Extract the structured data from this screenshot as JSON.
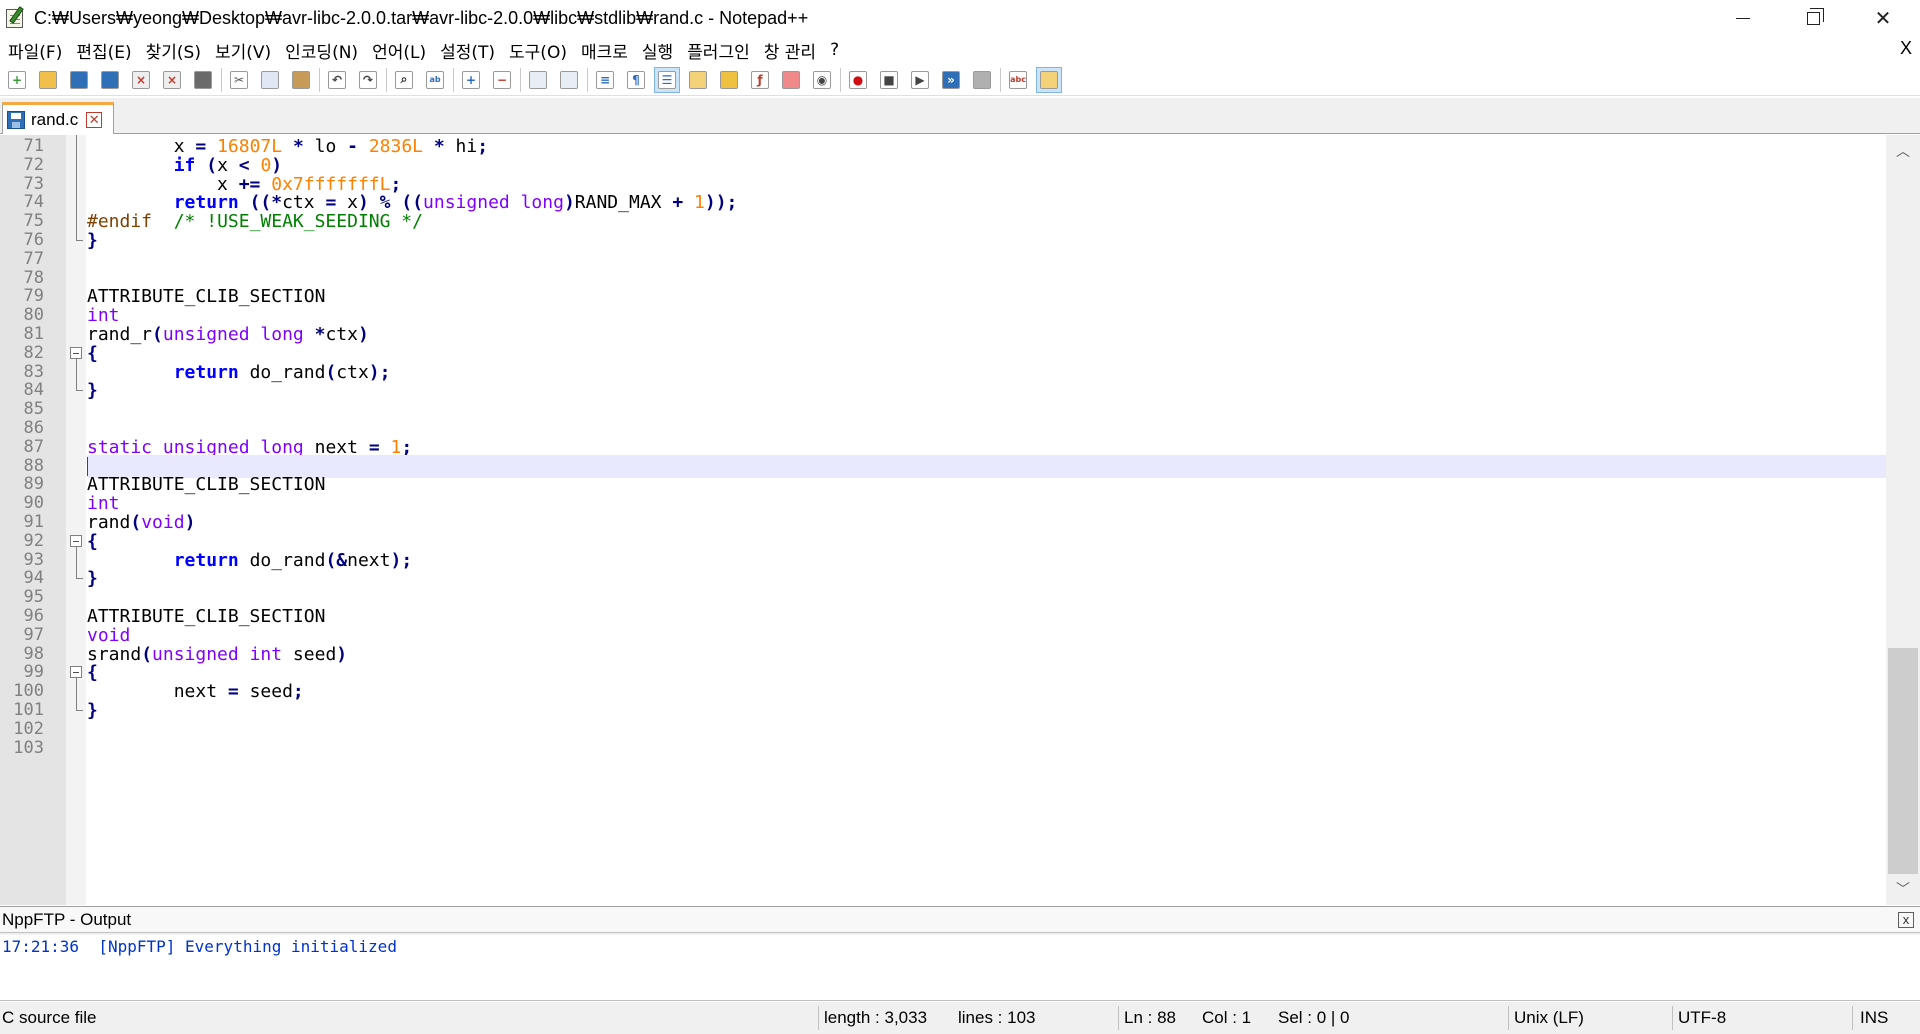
{
  "window": {
    "title": "C:₩Users₩yeong₩Desktop₩avr-libc-2.0.0.tar₩avr-libc-2.0.0₩libc₩stdlib₩rand.c - Notepad++",
    "menu_close": "X"
  },
  "menu": [
    "파일(F)",
    "편집(E)",
    "찾기(S)",
    "보기(V)",
    "인코딩(N)",
    "언어(L)",
    "설정(T)",
    "도구(O)",
    "매크로",
    "실행",
    "플러그인",
    "창 관리",
    "?"
  ],
  "toolbar": {
    "icons": [
      "new-file-icon",
      "open-file-icon",
      "save-icon",
      "save-all-icon",
      "close-icon",
      "close-all-icon",
      "print-icon",
      "cut-icon",
      "copy-icon",
      "paste-icon",
      "undo-icon",
      "redo-icon",
      "find-icon",
      "replace-icon",
      "zoom-in-icon",
      "zoom-out-icon",
      "sync-vertical-icon",
      "sync-horizontal-icon",
      "word-wrap-icon",
      "show-all-chars-icon",
      "indent-guide-icon",
      "user-lang-icon",
      "doc-map-icon",
      "function-list-icon",
      "folder-workspace-icon",
      "monitoring-icon",
      "record-macro-icon",
      "stop-macro-icon",
      "play-macro-icon",
      "run-macro-multiple-icon",
      "save-macro-icon",
      "spell-check-icon",
      "nppftp-icon"
    ]
  },
  "tab": {
    "label": "rand.c"
  },
  "editor": {
    "current_line": 88,
    "lines": [
      {
        "n": 71,
        "tokens": [
          [
            "",
            "        x "
          ],
          [
            "op",
            "="
          ],
          [
            "",
            " "
          ],
          [
            "num",
            "16807L"
          ],
          [
            "",
            " "
          ],
          [
            "op",
            "*"
          ],
          [
            "",
            " lo "
          ],
          [
            "op",
            "-"
          ],
          [
            "",
            " "
          ],
          [
            "num",
            "2836L"
          ],
          [
            "",
            " "
          ],
          [
            "op",
            "*"
          ],
          [
            "",
            " hi"
          ],
          [
            "op",
            ";"
          ]
        ]
      },
      {
        "n": 72,
        "tokens": [
          [
            "",
            "        "
          ],
          [
            "kw",
            "if"
          ],
          [
            "",
            " "
          ],
          [
            "op",
            "("
          ],
          [
            "",
            "x "
          ],
          [
            "op",
            "<"
          ],
          [
            "",
            " "
          ],
          [
            "num",
            "0"
          ],
          [
            "op",
            ")"
          ]
        ]
      },
      {
        "n": 73,
        "tokens": [
          [
            "",
            "            x "
          ],
          [
            "op",
            "+="
          ],
          [
            "",
            " "
          ],
          [
            "num",
            "0x7fffffffL"
          ],
          [
            "op",
            ";"
          ]
        ]
      },
      {
        "n": 74,
        "tokens": [
          [
            "",
            "        "
          ],
          [
            "kw",
            "return"
          ],
          [
            "",
            " "
          ],
          [
            "op",
            "((*"
          ],
          [
            "",
            "ctx "
          ],
          [
            "op",
            "="
          ],
          [
            "",
            " x"
          ],
          [
            "op",
            ")"
          ],
          [
            "",
            " "
          ],
          [
            "op",
            "%"
          ],
          [
            "",
            " "
          ],
          [
            "op",
            "(("
          ],
          [
            "ty",
            "unsigned"
          ],
          [
            "",
            " "
          ],
          [
            "ty",
            "long"
          ],
          [
            "op",
            ")"
          ],
          [
            "",
            "RAND_MAX "
          ],
          [
            "op",
            "+"
          ],
          [
            "",
            " "
          ],
          [
            "num",
            "1"
          ],
          [
            "op",
            "));"
          ]
        ]
      },
      {
        "n": 75,
        "tokens": [
          [
            "pp",
            "#endif"
          ],
          [
            "",
            "  "
          ],
          [
            "cm",
            "/* !USE_WEAK_SEEDING */"
          ]
        ]
      },
      {
        "n": 76,
        "tokens": [
          [
            "op",
            "}"
          ]
        ]
      },
      {
        "n": 77,
        "tokens": []
      },
      {
        "n": 78,
        "tokens": []
      },
      {
        "n": 79,
        "tokens": [
          [
            "",
            "ATTRIBUTE_CLIB_SECTION"
          ]
        ]
      },
      {
        "n": 80,
        "tokens": [
          [
            "ty",
            "int"
          ]
        ]
      },
      {
        "n": 81,
        "tokens": [
          [
            "",
            "rand_r"
          ],
          [
            "op",
            "("
          ],
          [
            "ty",
            "unsigned"
          ],
          [
            "",
            " "
          ],
          [
            "ty",
            "long"
          ],
          [
            "",
            " "
          ],
          [
            "op",
            "*"
          ],
          [
            "",
            "ctx"
          ],
          [
            "op",
            ")"
          ]
        ]
      },
      {
        "n": 82,
        "tokens": [
          [
            "op",
            "{"
          ]
        ]
      },
      {
        "n": 83,
        "tokens": [
          [
            "",
            "        "
          ],
          [
            "kw",
            "return"
          ],
          [
            "",
            " do_rand"
          ],
          [
            "op",
            "("
          ],
          [
            "",
            "ctx"
          ],
          [
            "op",
            ");"
          ]
        ]
      },
      {
        "n": 84,
        "tokens": [
          [
            "op",
            "}"
          ]
        ]
      },
      {
        "n": 85,
        "tokens": []
      },
      {
        "n": 86,
        "tokens": []
      },
      {
        "n": 87,
        "tokens": [
          [
            "ty",
            "static"
          ],
          [
            "",
            " "
          ],
          [
            "ty",
            "unsigned"
          ],
          [
            "",
            " "
          ],
          [
            "ty",
            "long"
          ],
          [
            "",
            " next "
          ],
          [
            "op",
            "="
          ],
          [
            "",
            " "
          ],
          [
            "num",
            "1"
          ],
          [
            "op",
            ";"
          ]
        ]
      },
      {
        "n": 88,
        "tokens": []
      },
      {
        "n": 89,
        "tokens": [
          [
            "",
            "ATTRIBUTE_CLIB_SECTION"
          ]
        ]
      },
      {
        "n": 90,
        "tokens": [
          [
            "ty",
            "int"
          ]
        ]
      },
      {
        "n": 91,
        "tokens": [
          [
            "",
            "rand"
          ],
          [
            "op",
            "("
          ],
          [
            "ty",
            "void"
          ],
          [
            "op",
            ")"
          ]
        ]
      },
      {
        "n": 92,
        "tokens": [
          [
            "op",
            "{"
          ]
        ]
      },
      {
        "n": 93,
        "tokens": [
          [
            "",
            "        "
          ],
          [
            "kw",
            "return"
          ],
          [
            "",
            " do_rand"
          ],
          [
            "op",
            "(&"
          ],
          [
            "",
            "next"
          ],
          [
            "op",
            ");"
          ]
        ]
      },
      {
        "n": 94,
        "tokens": [
          [
            "op",
            "}"
          ]
        ]
      },
      {
        "n": 95,
        "tokens": []
      },
      {
        "n": 96,
        "tokens": [
          [
            "",
            "ATTRIBUTE_CLIB_SECTION"
          ]
        ]
      },
      {
        "n": 97,
        "tokens": [
          [
            "ty",
            "void"
          ]
        ]
      },
      {
        "n": 98,
        "tokens": [
          [
            "",
            "srand"
          ],
          [
            "op",
            "("
          ],
          [
            "ty",
            "unsigned"
          ],
          [
            "",
            " "
          ],
          [
            "ty",
            "int"
          ],
          [
            "",
            " seed"
          ],
          [
            "op",
            ")"
          ]
        ]
      },
      {
        "n": 99,
        "tokens": [
          [
            "op",
            "{"
          ]
        ]
      },
      {
        "n": 100,
        "tokens": [
          [
            "",
            "        next "
          ],
          [
            "op",
            "="
          ],
          [
            "",
            " seed"
          ],
          [
            "op",
            ";"
          ]
        ]
      },
      {
        "n": 101,
        "tokens": [
          [
            "op",
            "}"
          ]
        ]
      },
      {
        "n": 102,
        "tokens": []
      },
      {
        "n": 103,
        "tokens": []
      }
    ]
  },
  "output": {
    "title": "NppFTP - Output",
    "close": "x",
    "lines": [
      "17:21:36  [NppFTP] Everything initialized"
    ]
  },
  "status": {
    "file_type": "C source file",
    "length": "length : 3,033",
    "lines": "lines : 103",
    "ln": "Ln : 88",
    "col": "Col : 1",
    "sel": "Sel : 0 | 0",
    "eol": "Unix (LF)",
    "encoding": "UTF-8",
    "mode": "INS"
  }
}
